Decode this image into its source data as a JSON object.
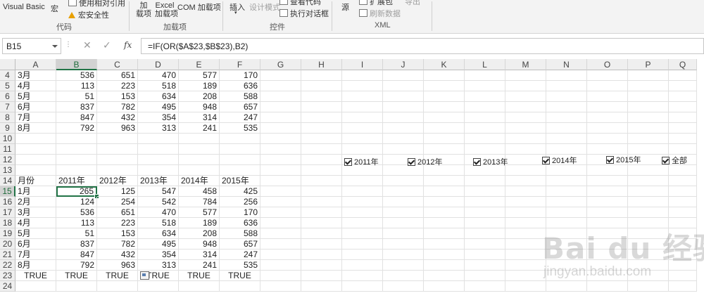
{
  "ribbon": {
    "code": {
      "visual_basic": "Visual Basic",
      "macro": "宏",
      "relative_ref": "使用相对引用",
      "macro_security": "宏安全性",
      "group_label": "代码"
    },
    "addins": {
      "addin": "加\n载项",
      "excel_addin": "Excel\n加载项",
      "com_addin": "COM 加载项",
      "group_label": "加载项"
    },
    "controls": {
      "insert": "插入",
      "design_mode": "设计模式",
      "view_code": "查看代码",
      "run_dialog": "执行对话框",
      "group_label": "控件"
    },
    "xml": {
      "source": "源",
      "expand_pack": "扩展包",
      "export": "导出",
      "refresh_data": "刷新数据",
      "group_label": "XML"
    }
  },
  "formula_bar": {
    "name_box": "B15",
    "fx": "fx",
    "formula": "=IF(OR($A$23,$B$23),B2)"
  },
  "columns": [
    "A",
    "B",
    "C",
    "D",
    "E",
    "F",
    "G",
    "H",
    "I",
    "J",
    "K",
    "L",
    "M",
    "N",
    "O",
    "P",
    "Q"
  ],
  "active_cell": "B15",
  "rows": [
    {
      "n": "4",
      "cells": [
        "3月",
        "536",
        "651",
        "470",
        "577",
        "170"
      ]
    },
    {
      "n": "5",
      "cells": [
        "4月",
        "113",
        "223",
        "518",
        "189",
        "636"
      ]
    },
    {
      "n": "6",
      "cells": [
        "5月",
        "51",
        "153",
        "634",
        "208",
        "588"
      ]
    },
    {
      "n": "7",
      "cells": [
        "6月",
        "837",
        "782",
        "495",
        "948",
        "657"
      ]
    },
    {
      "n": "8",
      "cells": [
        "7月",
        "847",
        "432",
        "354",
        "314",
        "247"
      ]
    },
    {
      "n": "9",
      "cells": [
        "8月",
        "792",
        "963",
        "313",
        "241",
        "535"
      ]
    },
    {
      "n": "10",
      "cells": []
    },
    {
      "n": "11",
      "cells": []
    },
    {
      "n": "12",
      "cells": []
    },
    {
      "n": "13",
      "cells": []
    },
    {
      "n": "14",
      "cells": [
        "月份",
        "2011年",
        "2012年",
        "2013年",
        "2014年",
        "2015年"
      ]
    },
    {
      "n": "15",
      "cells": [
        "1月",
        "265",
        "125",
        "547",
        "458",
        "425"
      ]
    },
    {
      "n": "16",
      "cells": [
        "2月",
        "124",
        "254",
        "542",
        "784",
        "256"
      ]
    },
    {
      "n": "17",
      "cells": [
        "3月",
        "536",
        "651",
        "470",
        "577",
        "170"
      ]
    },
    {
      "n": "18",
      "cells": [
        "4月",
        "113",
        "223",
        "518",
        "189",
        "636"
      ]
    },
    {
      "n": "19",
      "cells": [
        "5月",
        "51",
        "153",
        "634",
        "208",
        "588"
      ]
    },
    {
      "n": "20",
      "cells": [
        "6月",
        "837",
        "782",
        "495",
        "948",
        "657"
      ]
    },
    {
      "n": "21",
      "cells": [
        "7月",
        "847",
        "432",
        "354",
        "314",
        "247"
      ]
    },
    {
      "n": "22",
      "cells": [
        "8月",
        "792",
        "963",
        "313",
        "241",
        "535"
      ]
    },
    {
      "n": "23",
      "cells": [
        "TRUE",
        "TRUE",
        "TRUE",
        "TRUE",
        "TRUE",
        "TRUE"
      ]
    },
    {
      "n": "24",
      "cells": []
    }
  ],
  "checkboxes": [
    {
      "label": "2011年",
      "checked": true
    },
    {
      "label": "2012年",
      "checked": true
    },
    {
      "label": "2013年",
      "checked": true
    },
    {
      "label": "2014年",
      "checked": true
    },
    {
      "label": "2015年",
      "checked": true
    },
    {
      "label": "全部",
      "checked": true
    }
  ],
  "watermark": {
    "main": "Bai du 经验",
    "sub": "jingyan.baidu.com"
  }
}
